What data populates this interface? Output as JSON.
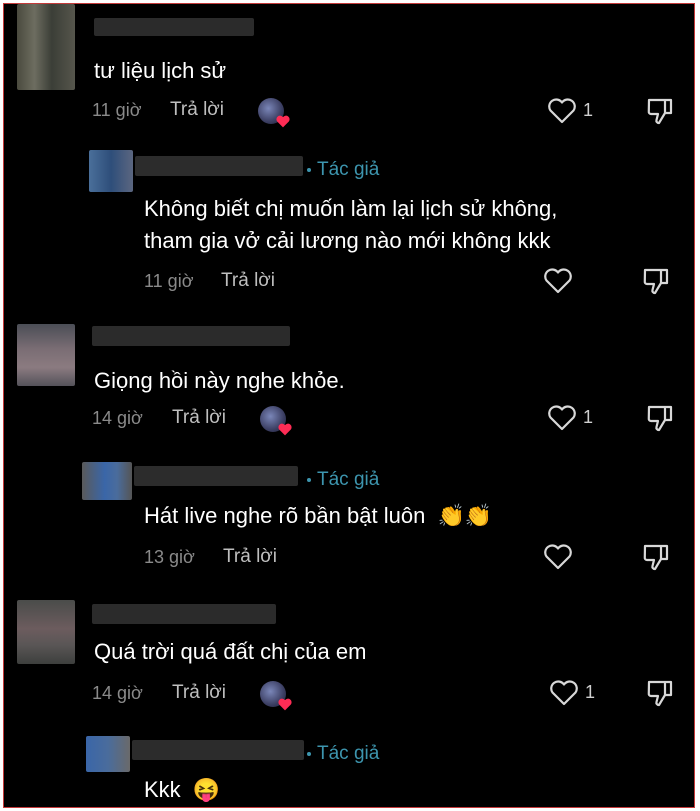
{
  "comments": [
    {
      "text": "tư liệu lịch sử",
      "time": "11 giờ",
      "reply_label": "Trả lời",
      "likes": "1",
      "reply": {
        "author_badge": "Tác giả",
        "text_lines": [
          "Không biết chị muốn làm lại lịch sử không,",
          "tham gia vở cải lương nào mới không kkk"
        ],
        "time": "11 giờ",
        "reply_label": "Trả lời"
      }
    },
    {
      "text": "Giọng hồi này nghe khỏe.",
      "time": "14 giờ",
      "reply_label": "Trả lời",
      "likes": "1",
      "reply": {
        "author_badge": "Tác giả",
        "text": "Hát live nghe rõ bần bật luôn",
        "emoji": "👏👏",
        "time": "13 giờ",
        "reply_label": "Trả lời"
      }
    },
    {
      "text": "Quá trời quá đất chị của em",
      "time": "14 giờ",
      "reply_label": "Trả lời",
      "likes": "1",
      "reply": {
        "author_badge": "Tác giả",
        "text": "Kkk",
        "emoji": "😝"
      }
    }
  ],
  "icons": {
    "like": "heart-outline-icon",
    "dislike": "thumbs-down-icon",
    "creator_liked": "creator-avatar-heart-icon"
  },
  "colors": {
    "background": "#000000",
    "author_badge": "#3d95ae",
    "frame_border": "#c43a3a",
    "heart_badge": "#fe2c55"
  }
}
